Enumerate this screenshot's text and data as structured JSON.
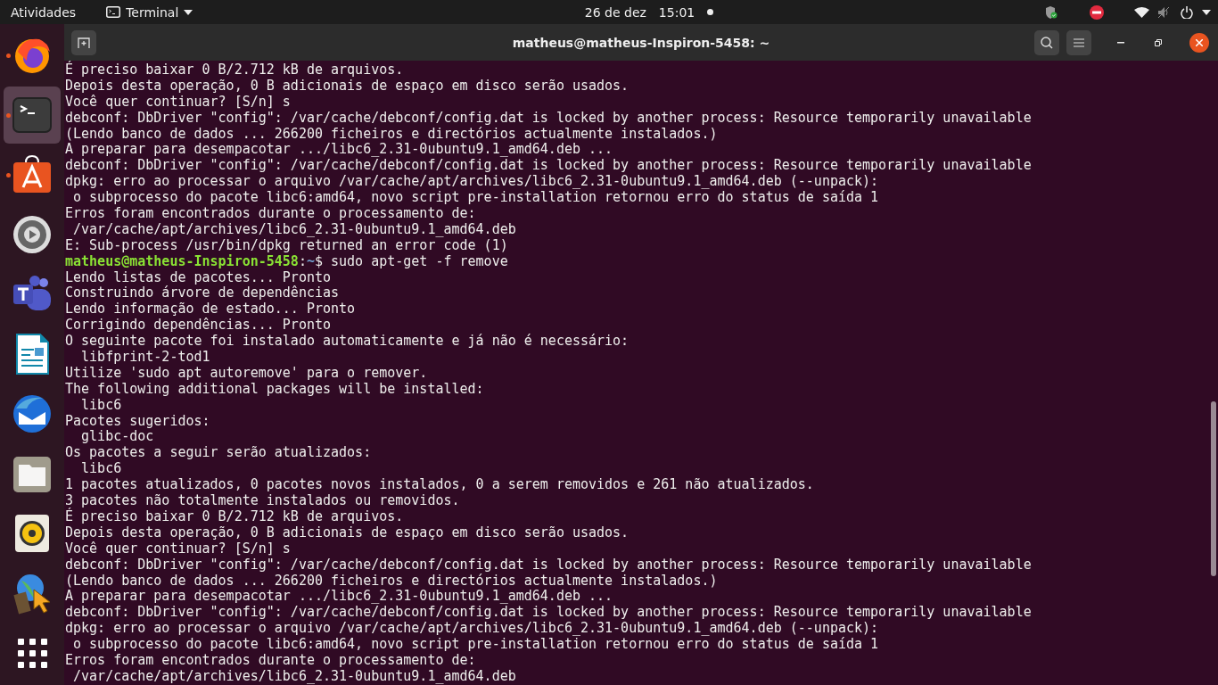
{
  "top_bar": {
    "activities": "Atividades",
    "app_menu": "Terminal",
    "date": "26 de dez",
    "time": "15:01",
    "notification": true
  },
  "dock": {
    "items": [
      {
        "kind": "browser",
        "running": true,
        "selected": false
      },
      {
        "kind": "terminal",
        "running": true,
        "selected": true
      },
      {
        "kind": "store",
        "running": true,
        "selected": false
      },
      {
        "kind": "settings",
        "running": false,
        "selected": false
      },
      {
        "kind": "chat",
        "running": false,
        "selected": false
      },
      {
        "kind": "document",
        "running": false,
        "selected": false
      },
      {
        "kind": "mail",
        "running": false,
        "selected": false
      },
      {
        "kind": "files",
        "running": false,
        "selected": false
      },
      {
        "kind": "music",
        "running": false,
        "selected": false
      },
      {
        "kind": "globe",
        "running": false,
        "selected": false
      },
      {
        "kind": "grid",
        "running": false,
        "selected": false
      }
    ]
  },
  "window": {
    "title": "matheus@matheus-Inspiron-5458: ~"
  },
  "terminal": {
    "lines": [
      {
        "kind": "text",
        "text": "É preciso baixar 0 B/2.712 kB de arquivos."
      },
      {
        "kind": "text",
        "text": "Depois desta operação, 0 B adicionais de espaço em disco serão usados."
      },
      {
        "kind": "text",
        "text": "Você quer continuar? [S/n] s"
      },
      {
        "kind": "text",
        "text": "debconf: DbDriver \"config\": /var/cache/debconf/config.dat is locked by another process: Resource temporarily unavailable"
      },
      {
        "kind": "text",
        "text": "(Lendo banco de dados ... 266200 ficheiros e directórios actualmente instalados.)"
      },
      {
        "kind": "text",
        "text": "A preparar para desempacotar .../libc6_2.31-0ubuntu9.1_amd64.deb ..."
      },
      {
        "kind": "text",
        "text": "debconf: DbDriver \"config\": /var/cache/debconf/config.dat is locked by another process: Resource temporarily unavailable"
      },
      {
        "kind": "text",
        "text": "dpkg: erro ao processar o arquivo /var/cache/apt/archives/libc6_2.31-0ubuntu9.1_amd64.deb (--unpack):"
      },
      {
        "kind": "text",
        "text": " o subprocesso do pacote libc6:amd64, novo script pre-installation retornou erro do status de saída 1"
      },
      {
        "kind": "text",
        "text": "Erros foram encontrados durante o processamento de:"
      },
      {
        "kind": "text",
        "text": " /var/cache/apt/archives/libc6_2.31-0ubuntu9.1_amd64.deb"
      },
      {
        "kind": "text",
        "text": "E: Sub-process /usr/bin/dpkg returned an error code (1)"
      },
      {
        "kind": "prompt",
        "user": "matheus@matheus-Inspiron-5458",
        "sep": ":",
        "path": "~",
        "command": "$ sudo apt-get -f remove"
      },
      {
        "kind": "text",
        "text": "Lendo listas de pacotes... Pronto"
      },
      {
        "kind": "text",
        "text": "Construindo árvore de dependências"
      },
      {
        "kind": "text",
        "text": "Lendo informação de estado... Pronto"
      },
      {
        "kind": "text",
        "text": "Corrigindo dependências... Pronto"
      },
      {
        "kind": "text",
        "text": "O seguinte pacote foi instalado automaticamente e já não é necessário:"
      },
      {
        "kind": "text",
        "text": "  libfprint-2-tod1"
      },
      {
        "kind": "text",
        "text": "Utilize 'sudo apt autoremove' para o remover."
      },
      {
        "kind": "text",
        "text": "The following additional packages will be installed:"
      },
      {
        "kind": "text",
        "text": "  libc6"
      },
      {
        "kind": "text",
        "text": "Pacotes sugeridos:"
      },
      {
        "kind": "text",
        "text": "  glibc-doc"
      },
      {
        "kind": "text",
        "text": "Os pacotes a seguir serão atualizados:"
      },
      {
        "kind": "text",
        "text": "  libc6"
      },
      {
        "kind": "text",
        "text": "1 pacotes atualizados, 0 pacotes novos instalados, 0 a serem removidos e 261 não atualizados."
      },
      {
        "kind": "text",
        "text": "3 pacotes não totalmente instalados ou removidos."
      },
      {
        "kind": "text",
        "text": "É preciso baixar 0 B/2.712 kB de arquivos."
      },
      {
        "kind": "text",
        "text": "Depois desta operação, 0 B adicionais de espaço em disco serão usados."
      },
      {
        "kind": "text",
        "text": "Você quer continuar? [S/n] s"
      },
      {
        "kind": "text",
        "text": "debconf: DbDriver \"config\": /var/cache/debconf/config.dat is locked by another process: Resource temporarily unavailable"
      },
      {
        "kind": "text",
        "text": "(Lendo banco de dados ... 266200 ficheiros e directórios actualmente instalados.)"
      },
      {
        "kind": "text",
        "text": "A preparar para desempacotar .../libc6_2.31-0ubuntu9.1_amd64.deb ..."
      },
      {
        "kind": "text",
        "text": "debconf: DbDriver \"config\": /var/cache/debconf/config.dat is locked by another process: Resource temporarily unavailable"
      },
      {
        "kind": "text",
        "text": "dpkg: erro ao processar o arquivo /var/cache/apt/archives/libc6_2.31-0ubuntu9.1_amd64.deb (--unpack):"
      },
      {
        "kind": "text",
        "text": " o subprocesso do pacote libc6:amd64, novo script pre-installation retornou erro do status de saída 1"
      },
      {
        "kind": "text",
        "text": "Erros foram encontrados durante o processamento de:"
      },
      {
        "kind": "text",
        "text": " /var/cache/apt/archives/libc6_2.31-0ubuntu9.1_amd64.deb"
      }
    ]
  }
}
